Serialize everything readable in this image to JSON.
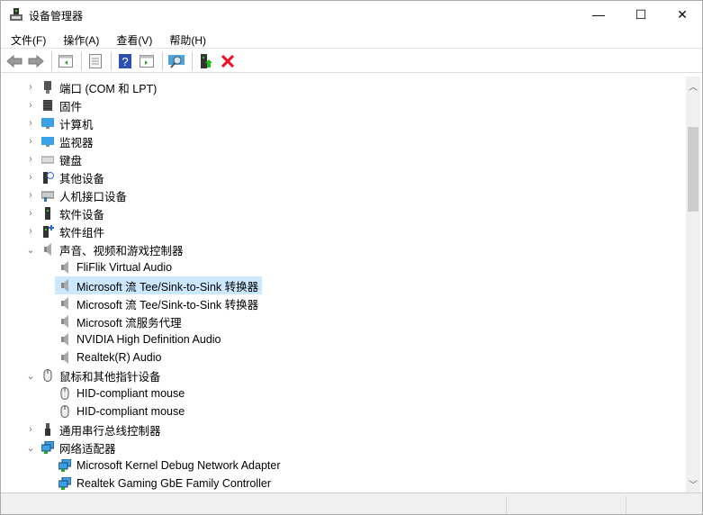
{
  "window": {
    "title": "设备管理器",
    "minimize": "—",
    "maximize": "☐",
    "close": "✕"
  },
  "menu": [
    "文件(F)",
    "操作(A)",
    "查看(V)",
    "帮助(H)"
  ],
  "toolbar": [
    "back-icon",
    "forward-icon",
    "show-hide-console-tree-icon",
    "properties-icon",
    "help-icon",
    "action-pane-icon",
    "scan-hardware-icon",
    "update-driver-icon",
    "uninstall-icon"
  ],
  "tree": [
    {
      "level": 0,
      "label": "端口 (COM 和 LPT)",
      "expanded": false,
      "icon": "port-icon"
    },
    {
      "level": 0,
      "label": "固件",
      "expanded": false,
      "icon": "firmware-icon"
    },
    {
      "level": 0,
      "label": "计算机",
      "expanded": false,
      "icon": "computer-icon"
    },
    {
      "level": 0,
      "label": "监视器",
      "expanded": false,
      "icon": "monitor-icon"
    },
    {
      "level": 0,
      "label": "键盘",
      "expanded": false,
      "icon": "keyboard-icon"
    },
    {
      "level": 0,
      "label": "其他设备",
      "expanded": false,
      "icon": "other-device-icon"
    },
    {
      "level": 0,
      "label": "人机接口设备",
      "expanded": false,
      "icon": "hid-icon"
    },
    {
      "level": 0,
      "label": "软件设备",
      "expanded": false,
      "icon": "software-device-icon"
    },
    {
      "level": 0,
      "label": "软件组件",
      "expanded": false,
      "icon": "software-component-icon"
    },
    {
      "level": 0,
      "label": "声音、视频和游戏控制器",
      "expanded": true,
      "icon": "speaker-icon"
    },
    {
      "level": 1,
      "label": "FliFlik Virtual Audio",
      "icon": "speaker-icon"
    },
    {
      "level": 1,
      "label": "Microsoft 流 Tee/Sink-to-Sink 转换器",
      "icon": "speaker-icon",
      "selected": true
    },
    {
      "level": 1,
      "label": "Microsoft 流 Tee/Sink-to-Sink 转换器",
      "icon": "speaker-icon"
    },
    {
      "level": 1,
      "label": "Microsoft 流服务代理",
      "icon": "speaker-icon"
    },
    {
      "level": 1,
      "label": "NVIDIA High Definition Audio",
      "icon": "speaker-icon"
    },
    {
      "level": 1,
      "label": "Realtek(R) Audio",
      "icon": "speaker-icon"
    },
    {
      "level": 0,
      "label": "鼠标和其他指针设备",
      "expanded": true,
      "icon": "mouse-icon"
    },
    {
      "level": 1,
      "label": "HID-compliant mouse",
      "icon": "mouse-icon"
    },
    {
      "level": 1,
      "label": "HID-compliant mouse",
      "icon": "mouse-icon"
    },
    {
      "level": 0,
      "label": "通用串行总线控制器",
      "expanded": false,
      "icon": "usb-icon"
    },
    {
      "level": 0,
      "label": "网络适配器",
      "expanded": true,
      "icon": "network-icon"
    },
    {
      "level": 1,
      "label": "Microsoft Kernel Debug Network Adapter",
      "icon": "network-icon"
    },
    {
      "level": 1,
      "label": "Realtek Gaming GbE Family Controller",
      "icon": "network-icon"
    }
  ],
  "colors": {
    "selection": "#cce8ff",
    "uninstall": "#e81123",
    "help": "#2d4fb0"
  }
}
